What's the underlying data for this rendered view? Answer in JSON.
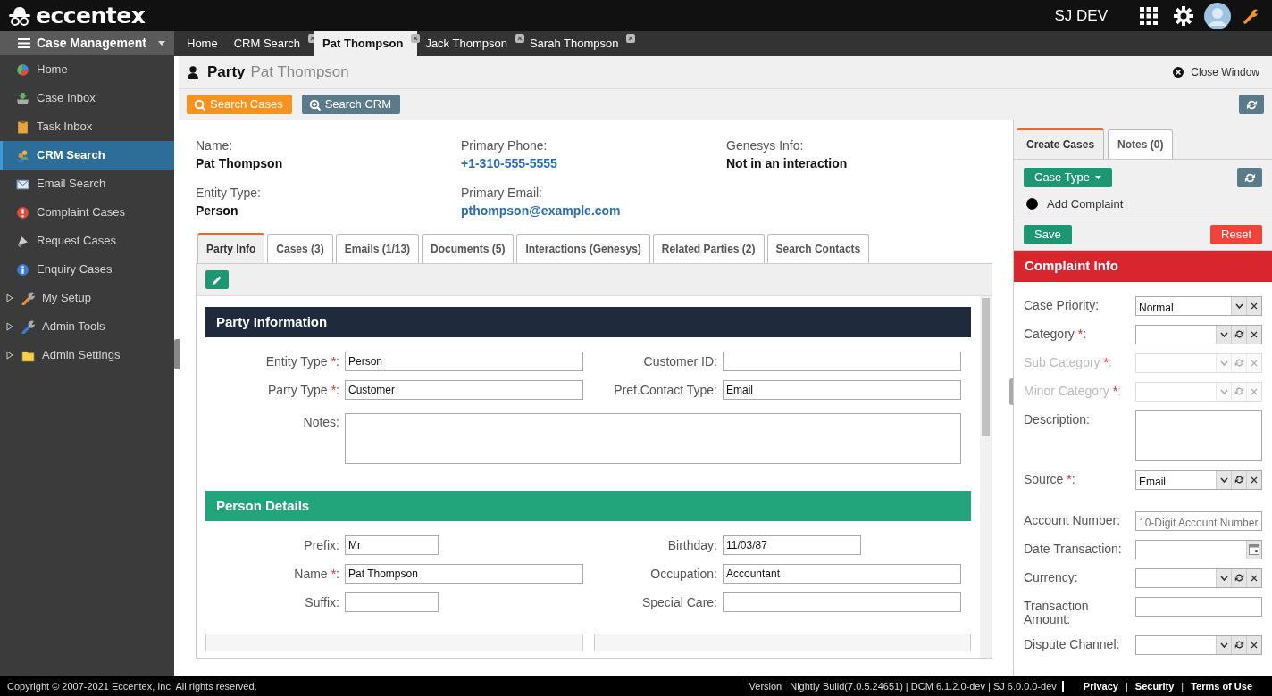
{
  "brand": {
    "logo": "eccentex"
  },
  "header": {
    "env": "SJ DEV"
  },
  "sidebar": {
    "title": "Case Management",
    "items": [
      {
        "label": "Home",
        "selected": false,
        "expandable": false
      },
      {
        "label": "Case Inbox",
        "selected": false,
        "expandable": false
      },
      {
        "label": "Task Inbox",
        "selected": false,
        "expandable": false
      },
      {
        "label": "CRM Search",
        "selected": true,
        "expandable": false
      },
      {
        "label": "Email Search",
        "selected": false,
        "expandable": false
      },
      {
        "label": "Complaint Cases",
        "selected": false,
        "expandable": false
      },
      {
        "label": "Request Cases",
        "selected": false,
        "expandable": false
      },
      {
        "label": "Enquiry Cases",
        "selected": false,
        "expandable": false
      },
      {
        "label": "My Setup",
        "selected": false,
        "expandable": true
      },
      {
        "label": "Admin Tools",
        "selected": false,
        "expandable": true
      },
      {
        "label": "Admin Settings",
        "selected": false,
        "expandable": true
      }
    ]
  },
  "open_tabs": [
    {
      "label": "Home",
      "selected": false,
      "closable": false
    },
    {
      "label": "CRM Search",
      "selected": false,
      "closable": true
    },
    {
      "label": "Pat Thompson",
      "selected": true,
      "closable": true
    },
    {
      "label": "Jack Thompson",
      "selected": false,
      "closable": true
    },
    {
      "label": "Sarah Thompson",
      "selected": false,
      "closable": true
    }
  ],
  "page": {
    "title": "Party",
    "subtitle": "Pat Thompson",
    "close": "Close Window"
  },
  "toolbar": [
    {
      "label": "Search Cases",
      "kind": "search"
    },
    {
      "label": "Search CRM",
      "kind": "zoom"
    }
  ],
  "summary": [
    {
      "label": "Name:",
      "value": "Pat Thompson",
      "link": false
    },
    {
      "label": "Primary Phone:",
      "value": "+1-310-555-5555",
      "link": true
    },
    {
      "label": "Genesys Info:",
      "value": "Not in an interaction",
      "link": false
    },
    {
      "label": "Entity Type:",
      "value": "Person",
      "link": false
    },
    {
      "label": "Primary Email:",
      "value": "pthompson@example.com",
      "link": true
    }
  ],
  "detail_tabs": [
    {
      "label": "Party Info",
      "selected": true
    },
    {
      "label": "Cases (3)",
      "selected": false
    },
    {
      "label": "Emails (1/13)",
      "selected": false
    },
    {
      "label": "Documents (5)",
      "selected": false
    },
    {
      "label": "Interactions (Genesys)",
      "selected": false
    },
    {
      "label": "Related Parties (2)",
      "selected": false
    },
    {
      "label": "Search Contacts",
      "selected": false
    }
  ],
  "sections": [
    {
      "title": "Party Information",
      "color": "#1f2a3c",
      "rows": [
        [
          {
            "label": "Entity Type",
            "mark": "*",
            "tail": ":",
            "value": "Person",
            "kind": "text"
          },
          {
            "label": "Customer ID:",
            "kind": "text"
          }
        ],
        [
          {
            "label": "Party Type",
            "mark": "*",
            "tail": ":",
            "value": "Customer",
            "kind": "text"
          },
          {
            "label": "Pref.Contact Type:",
            "value": "Email",
            "kind": "text"
          }
        ],
        [
          {
            "label": "Notes:",
            "kind": "textarea"
          }
        ]
      ]
    },
    {
      "title": "Person Details",
      "color": "#22a57b",
      "rows": [
        [
          {
            "label": "Prefix:",
            "value": "Mr",
            "kind": "short"
          },
          {
            "label": "Birthday:",
            "value": "11/03/87",
            "kind": "medium"
          }
        ],
        [
          {
            "label": "Name",
            "mark": "*",
            "tail": ":",
            "value": "Pat Thompson",
            "kind": "text"
          },
          {
            "label": "Occupation:",
            "value": "Accountant",
            "kind": "text"
          }
        ],
        [
          {
            "label": "Suffix:",
            "kind": "short"
          },
          {
            "label": "Special Care:",
            "kind": "text"
          }
        ]
      ]
    }
  ],
  "right_tabs": [
    {
      "label": "Create Cases",
      "selected": true
    },
    {
      "label": "Notes (0)",
      "selected": false
    }
  ],
  "case_type": {
    "label": "Case Type",
    "option": "Add Complaint",
    "checked": true
  },
  "actions": [
    {
      "label": "Save",
      "kind": "save"
    },
    {
      "label": "Reset",
      "kind": "reset"
    }
  ],
  "complaint": {
    "title": "Complaint Info",
    "fields": [
      {
        "label": "Case Priority:",
        "kind": "select",
        "value": "Normal",
        "refresh": false,
        "disabled": false
      },
      {
        "label": "Category",
        "mark": "*",
        "tail": ":",
        "kind": "select",
        "refresh": true,
        "disabled": false
      },
      {
        "label": "Sub Category",
        "mark": "*",
        "tail": ":",
        "kind": "select",
        "refresh": true,
        "disabled": true
      },
      {
        "label": "Minor Category",
        "mark": "*",
        "tail": ":",
        "kind": "select",
        "refresh": true,
        "disabled": true
      },
      {
        "label": "Description:",
        "kind": "textarea",
        "disabled": false
      },
      {
        "label": "Source",
        "mark": "*",
        "tail": ":",
        "kind": "select",
        "value": "Email",
        "refresh": true,
        "disabled": false
      },
      {
        "label": "Account Number:",
        "kind": "text",
        "placeholder": "10-Digit Account Number",
        "disabled": false
      },
      {
        "label": "Date Transaction:",
        "kind": "date",
        "disabled": false
      },
      {
        "label": "Currency:",
        "kind": "select",
        "refresh": true,
        "disabled": false
      },
      {
        "label": "Transaction Amount:",
        "kind": "text",
        "disabled": false
      },
      {
        "label": "Dispute Channel:",
        "kind": "select",
        "refresh": true,
        "disabled": false
      }
    ]
  },
  "footer": {
    "copyright": "Copyright © 2007-2021 Eccentex, Inc. All rights reserved.",
    "version_label": "Version",
    "version": "Nightly Build(7.0.5.24651) | DCM 6.1.2.0-dev | SJ 6.0.0.0-dev",
    "links": [
      "Privacy",
      "Security",
      "Terms of Use"
    ],
    "separator": "|"
  }
}
